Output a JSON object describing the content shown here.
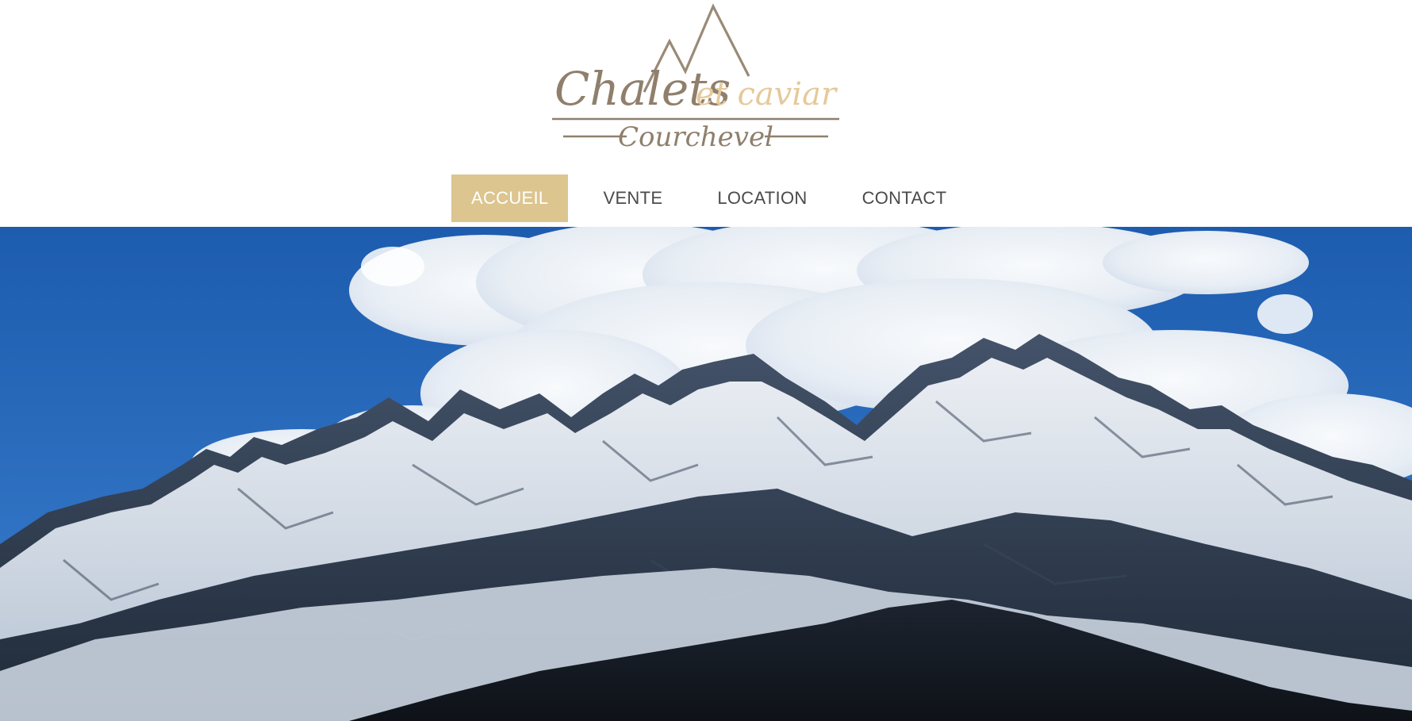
{
  "brand": {
    "logo_title_part1": "Chalets",
    "logo_title_part2": "et caviar",
    "logo_subtitle": "Courchevel",
    "colors": {
      "logo_taupe": "#8f7f6c",
      "logo_gold": "#e6c99a"
    }
  },
  "nav": {
    "items": [
      {
        "label": "ACCUEIL",
        "active": true
      },
      {
        "label": "VENTE",
        "active": false
      },
      {
        "label": "LOCATION",
        "active": false
      },
      {
        "label": "CONTACT",
        "active": false
      }
    ],
    "active_color": "#dcc58f",
    "text_color": "#4a4a4a"
  },
  "hero": {
    "image": "snow-capped-mountain-range-under-blue-sky-with-clouds",
    "sky_color": "#2366b8"
  }
}
